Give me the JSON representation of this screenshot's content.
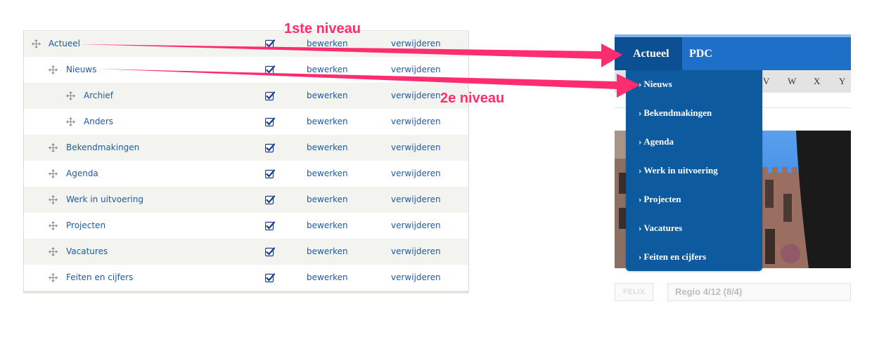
{
  "menu_table": {
    "edit_label": "bewerken",
    "delete_label": "verwijderen",
    "rows": [
      {
        "title": "Actueel",
        "level": 1,
        "enabled": true
      },
      {
        "title": "Nieuws",
        "level": 2,
        "enabled": true
      },
      {
        "title": "Archief",
        "level": 3,
        "enabled": true
      },
      {
        "title": "Anders",
        "level": 3,
        "enabled": true
      },
      {
        "title": "Bekendmakingen",
        "level": 2,
        "enabled": true
      },
      {
        "title": "Agenda",
        "level": 2,
        "enabled": true
      },
      {
        "title": "Werk in uitvoering",
        "level": 2,
        "enabled": true
      },
      {
        "title": "Projecten",
        "level": 2,
        "enabled": true
      },
      {
        "title": "Vacatures",
        "level": 2,
        "enabled": true
      },
      {
        "title": "Feiten en cijfers",
        "level": 2,
        "enabled": true
      }
    ]
  },
  "site_preview": {
    "nav_tabs": [
      {
        "label": "Actueel",
        "active": true
      },
      {
        "label": "PDC",
        "active": false
      }
    ],
    "letters": [
      "V",
      "W",
      "X",
      "Y"
    ],
    "dropdown_items": [
      {
        "label": "Nieuws",
        "chevron": "›"
      },
      {
        "label": "Bekendmakingen",
        "chevron": "›"
      },
      {
        "label": "Agenda",
        "chevron": "›"
      },
      {
        "label": "Werk in uitvoering",
        "chevron": "›"
      },
      {
        "label": "Projecten",
        "chevron": "›"
      },
      {
        "label": "Vacatures",
        "chevron": "›"
      },
      {
        "label": "Feiten en cijfers",
        "chevron": "›"
      }
    ],
    "sub_tab_label": "FELIX",
    "region_label": "Regio 4/12 (8/4)"
  },
  "annotations": {
    "level1": "1ste niveau",
    "level2": "2e niveau"
  },
  "colors": {
    "link": "#1f5aa6",
    "nav_blue": "#1d6fc7",
    "nav_active": "#0d4f93",
    "dropdown": "#0d5a9e",
    "annotation": "#ff2d6f"
  },
  "icons": {
    "drag": "move-arrows-icon",
    "checkbox": "checked-checkbox-icon"
  }
}
